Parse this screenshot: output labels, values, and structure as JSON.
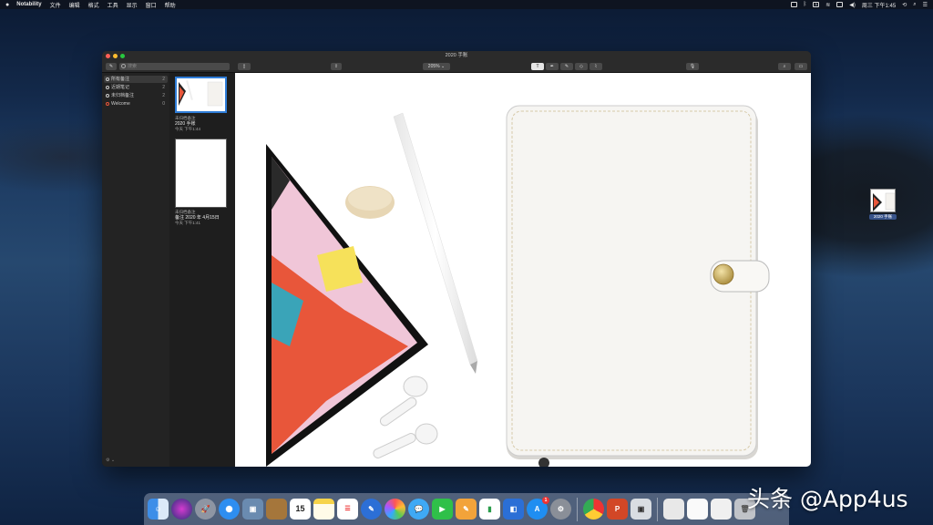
{
  "menubar": {
    "apple": "",
    "app_name": "Notability",
    "menus": [
      "文件",
      "编辑",
      "格式",
      "工具",
      "显示",
      "窗口",
      "帮助"
    ],
    "clock": "周三 下午1:45"
  },
  "window": {
    "title": "2020 手账",
    "search_placeholder": "搜索",
    "zoom": "205%",
    "sidebar": {
      "items": [
        {
          "label": "所有备注",
          "count": "2"
        },
        {
          "label": "近期笔记",
          "count": "2"
        },
        {
          "label": "未归档备注",
          "count": "2"
        },
        {
          "label": "Welcome",
          "count": "0"
        }
      ],
      "footer": "⚙ ⌄"
    },
    "notes": [
      {
        "category": "未归档备注",
        "title": "2020 手账",
        "date": "今天 下午1:44"
      },
      {
        "category": "未归档备注",
        "title": "备注 2020 年 4月15日",
        "date": "今天 下午1:41"
      }
    ]
  },
  "desktop_file": {
    "label": "2020 手账"
  },
  "dock": {
    "calendar_day": "15",
    "appstore_badge": "1",
    "powerpoint_letter": "P"
  },
  "watermark": "头条 @App4us",
  "colors": {
    "accent": "#2f7dd8",
    "tablet_screen_orange": "#e8563a",
    "tablet_screen_pink": "#f0c6d8"
  }
}
